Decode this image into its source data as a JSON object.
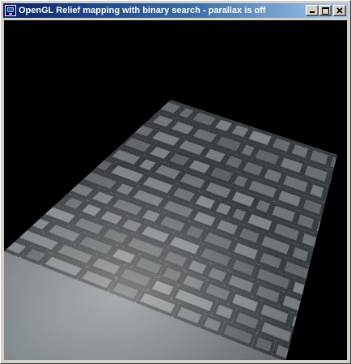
{
  "window": {
    "title": "OpenGL Relief mapping with binary search  - parallax is off",
    "icon": "opengl-app-icon",
    "buttons": {
      "minimize": "minimize-icon",
      "maximize": "maximize-icon",
      "close": "close-icon"
    }
  },
  "scene": {
    "background_color": "#000000",
    "surface": "stone-wall-relief-texture"
  },
  "colors": {
    "titlebar_start": "#0a246a",
    "titlebar_end": "#a6caf0",
    "frame": "#d4d0c8"
  }
}
